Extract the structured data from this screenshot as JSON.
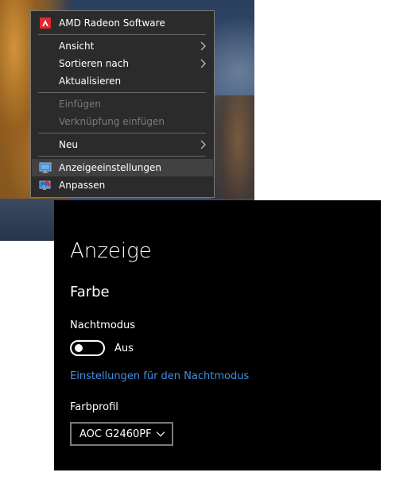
{
  "context_menu": {
    "items": [
      {
        "label": "AMD Radeon Software",
        "icon": "amd-radeon-icon"
      },
      {
        "label": "Ansicht",
        "submenu": true
      },
      {
        "label": "Sortieren nach",
        "submenu": true
      },
      {
        "label": "Aktualisieren"
      },
      {
        "label": "Einfügen",
        "disabled": true
      },
      {
        "label": "Verknüpfung einfügen",
        "disabled": true
      },
      {
        "label": "Neu",
        "submenu": true
      },
      {
        "label": "Anzeigeeinstellungen",
        "icon": "display-settings-icon",
        "highlighted": true
      },
      {
        "label": "Anpassen",
        "icon": "personalize-icon"
      }
    ]
  },
  "settings": {
    "page_title": "Anzeige",
    "section_title": "Farbe",
    "night_mode": {
      "label": "Nachtmodus",
      "state": "Aus",
      "enabled": false
    },
    "night_mode_link": "Einstellungen für den Nachtmodus",
    "color_profile": {
      "label": "Farbprofil",
      "value": "AOC G2460PF"
    }
  },
  "colors": {
    "menu_background": "#2b2b2b",
    "menu_highlight": "#414141",
    "menu_disabled_text": "#7b7b7b",
    "panel_background": "#000000",
    "link": "#3f8fe6",
    "amd_red": "#e3262f"
  }
}
